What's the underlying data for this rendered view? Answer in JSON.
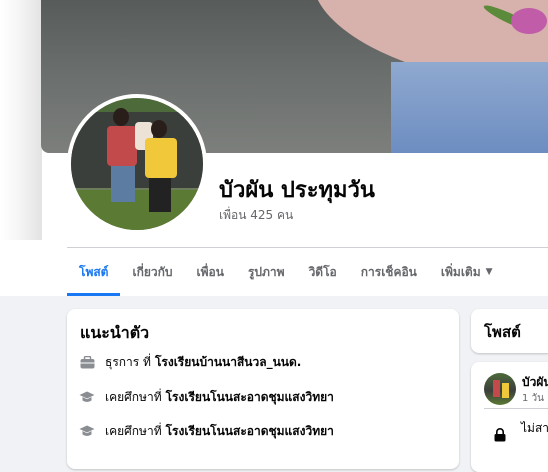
{
  "profile": {
    "name": "บัวผัน ประทุมวัน",
    "friends": "เพื่อน 425 คน"
  },
  "tabs": [
    {
      "label": "โพสต์",
      "active": true
    },
    {
      "label": "เกี่ยวกับ",
      "active": false
    },
    {
      "label": "เพื่อน",
      "active": false
    },
    {
      "label": "รูปภาพ",
      "active": false
    },
    {
      "label": "วิดีโอ",
      "active": false
    },
    {
      "label": "การเช็คอิน",
      "active": false
    },
    {
      "label": "เพิ่มเติม",
      "active": false
    }
  ],
  "intro": {
    "title": "แนะนำตัว",
    "items": [
      {
        "icon": "briefcase-icon",
        "prefix": "ธุรการ ที่",
        "place": "โรงเรียนบ้านนาสีนวล_นนด."
      },
      {
        "icon": "graduation-cap-icon",
        "prefix": "เคยศึกษาที่",
        "place": "โรงเรียนโนนสะอาดชุมแสงวิทยา"
      },
      {
        "icon": "graduation-cap-icon",
        "prefix": "เคยศึกษาที่",
        "place": "โรงเรียนโนนสะอาดชุมแสงวิทยา"
      }
    ]
  },
  "posts": {
    "title": "โพสต์",
    "author": "บัวผัน",
    "meta": "1 วัน ·",
    "text": "ไม่สา"
  },
  "colors": {
    "accent": "#1877f2",
    "text": "#050505",
    "secondary": "#65676b",
    "page_bg": "#f0f2f5"
  }
}
